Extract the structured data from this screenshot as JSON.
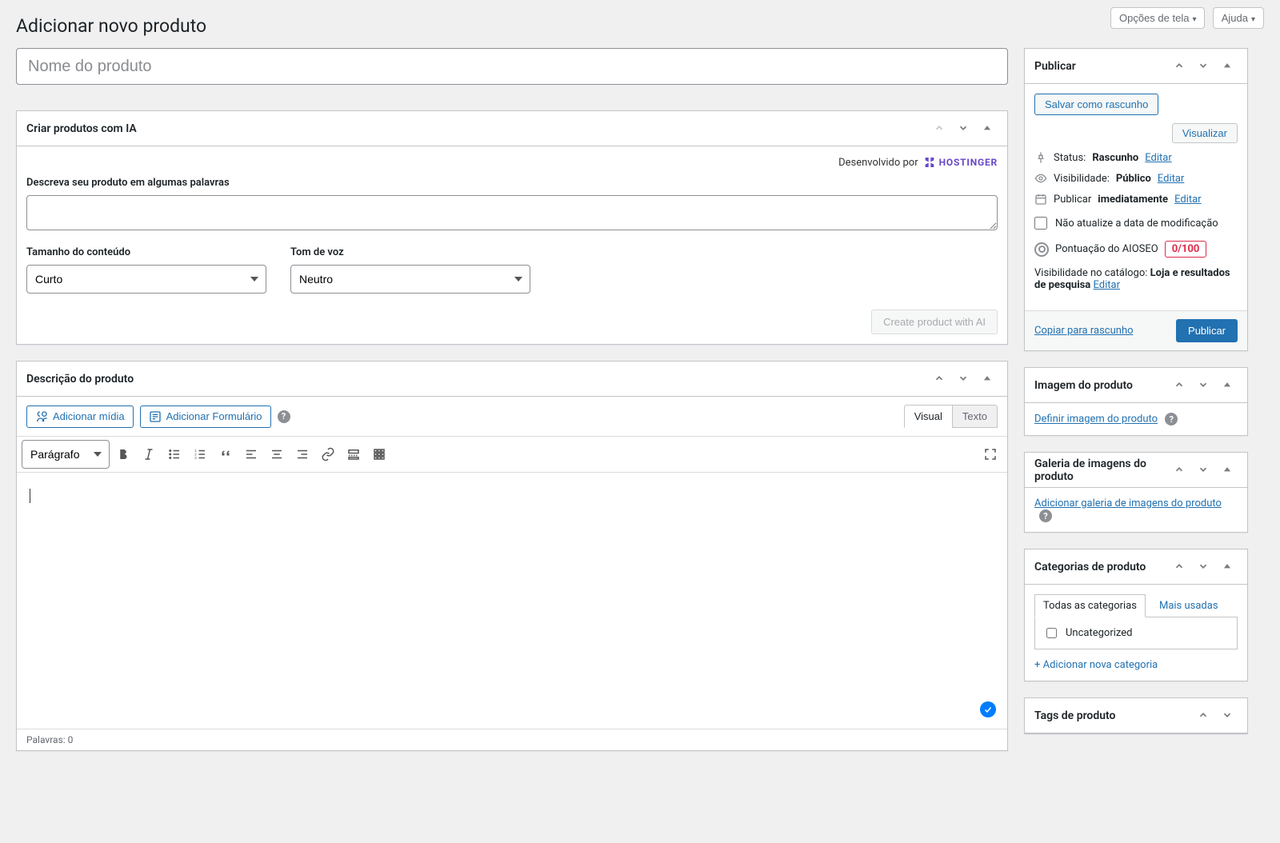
{
  "header": {
    "screen_options": "Opções de tela",
    "help": "Ajuda",
    "page_title": "Adicionar novo produto"
  },
  "title_field": {
    "placeholder": "Nome do produto",
    "value": ""
  },
  "ai_box": {
    "title": "Criar produtos com IA",
    "powered_by": "Desenvolvido por",
    "powered_brand": "HOSTINGER",
    "describe_label": "Descreva seu produto em algumas palavras",
    "describe_value": "",
    "length_label": "Tamanho do conteúdo",
    "length_value": "Curto",
    "tone_label": "Tom de voz",
    "tone_value": "Neutro",
    "submit": "Create product with AI"
  },
  "desc_box": {
    "title": "Descrição do produto",
    "add_media": "Adicionar mídia",
    "add_form": "Adicionar Formulário",
    "tab_visual": "Visual",
    "tab_text": "Texto",
    "format_select": "Parágrafo",
    "word_count": "Palavras: 0"
  },
  "publish_box": {
    "title": "Publicar",
    "save_draft": "Salvar como rascunho",
    "preview": "Visualizar",
    "status_label": "Status:",
    "status_value": "Rascunho",
    "status_edit": "Editar",
    "visibility_label": "Visibilidade:",
    "visibility_value": "Público",
    "visibility_edit": "Editar",
    "publish_label": "Publicar",
    "publish_value": "imediatamente",
    "publish_edit": "Editar",
    "no_update_date": "Não atualize a data de modificação",
    "aioseo_label": "Pontuação do AIOSEO",
    "aioseo_score": "0/100",
    "catalog_label": "Visibilidade no catálogo:",
    "catalog_value": "Loja e resultados de pesquisa",
    "catalog_edit": "Editar",
    "copy_draft": "Copiar para rascunho",
    "publish_btn": "Publicar"
  },
  "image_box": {
    "title": "Imagem do produto",
    "link": "Definir imagem do produto"
  },
  "gallery_box": {
    "title": "Galeria de imagens do produto",
    "link": "Adicionar galeria de imagens do produto"
  },
  "categories_box": {
    "title": "Categorias de produto",
    "tab_all": "Todas as categorias",
    "tab_used": "Mais usadas",
    "item_uncat": "Uncategorized",
    "add_new": "+ Adicionar nova categoria"
  },
  "tags_box": {
    "title": "Tags de produto"
  }
}
